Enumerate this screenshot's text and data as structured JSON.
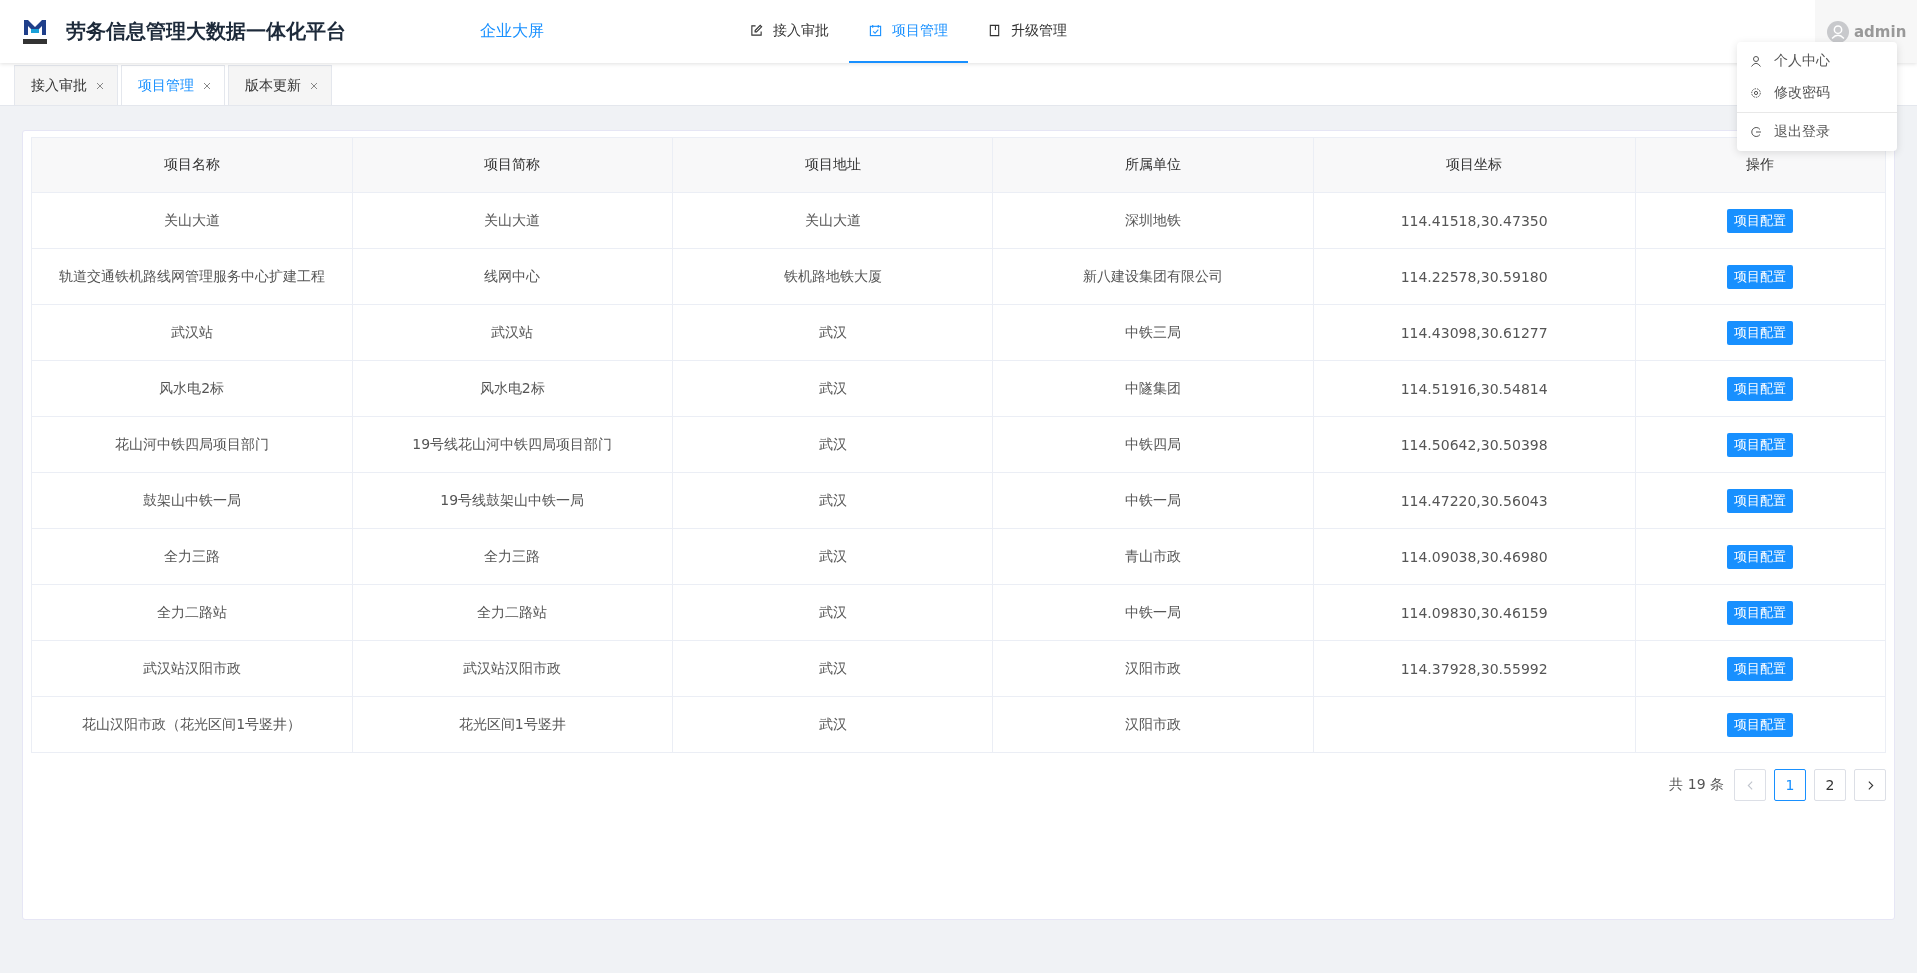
{
  "header": {
    "title": "劳务信息管理大数据一体化平台",
    "screen_link": "企业大屏",
    "nav": [
      {
        "label": "接入审批",
        "kind": "edit",
        "selected": false
      },
      {
        "label": "项目管理",
        "kind": "check",
        "selected": true
      },
      {
        "label": "升级管理",
        "kind": "doc",
        "selected": false
      }
    ],
    "user": "admin"
  },
  "user_menu": [
    {
      "label": "个人中心",
      "kind": "user",
      "divided": false
    },
    {
      "label": "修改密码",
      "kind": "gear",
      "divided": false
    },
    {
      "label": "退出登录",
      "kind": "logout",
      "divided": true
    }
  ],
  "tabs": [
    {
      "label": "接入审批",
      "selected": false
    },
    {
      "label": "项目管理",
      "selected": true
    },
    {
      "label": "版本更新",
      "selected": false
    }
  ],
  "table": {
    "columns": [
      "项目名称",
      "项目简称",
      "项目地址",
      "所属单位",
      "项目坐标",
      "操作"
    ],
    "rows": [
      [
        "关山大道",
        "关山大道",
        "关山大道",
        "深圳地铁",
        "114.41518,30.47350",
        "项目配置"
      ],
      [
        "轨道交通铁机路线网管理服务中心扩建工程",
        "线网中心",
        "铁机路地铁大厦",
        "新八建设集团有限公司",
        "114.22578,30.59180",
        "项目配置"
      ],
      [
        "武汉站",
        "武汉站",
        "武汉",
        "中铁三局",
        "114.43098,30.61277",
        "项目配置"
      ],
      [
        "风水电2标",
        "风水电2标",
        "武汉",
        "中隧集团",
        "114.51916,30.54814",
        "项目配置"
      ],
      [
        "花山河中铁四局项目部门",
        "19号线花山河中铁四局项目部门",
        "武汉",
        "中铁四局",
        "114.50642,30.50398",
        "项目配置"
      ],
      [
        "鼓架山中铁一局",
        "19号线鼓架山中铁一局",
        "武汉",
        "中铁一局",
        "114.47220,30.56043",
        "项目配置"
      ],
      [
        "全力三路",
        "全力三路",
        "武汉",
        "青山市政",
        "114.09038,30.46980",
        "项目配置"
      ],
      [
        "全力二路站",
        "全力二路站",
        "武汉",
        "中铁一局",
        "114.09830,30.46159",
        "项目配置"
      ],
      [
        "武汉站汉阳市政",
        "武汉站汉阳市政",
        "武汉",
        "汉阳市政",
        "114.37928,30.55992",
        "项目配置"
      ],
      [
        "花山汉阳市政（花光区间1号竖井）",
        "花光区间1号竖井",
        "武汉",
        "汉阳市政",
        "",
        "项目配置"
      ]
    ]
  },
  "pagination": {
    "total": "共 19 条",
    "prev_disabled": true,
    "pages": [
      {
        "label": "1",
        "selected": true
      },
      {
        "label": "2",
        "selected": false
      }
    ]
  }
}
